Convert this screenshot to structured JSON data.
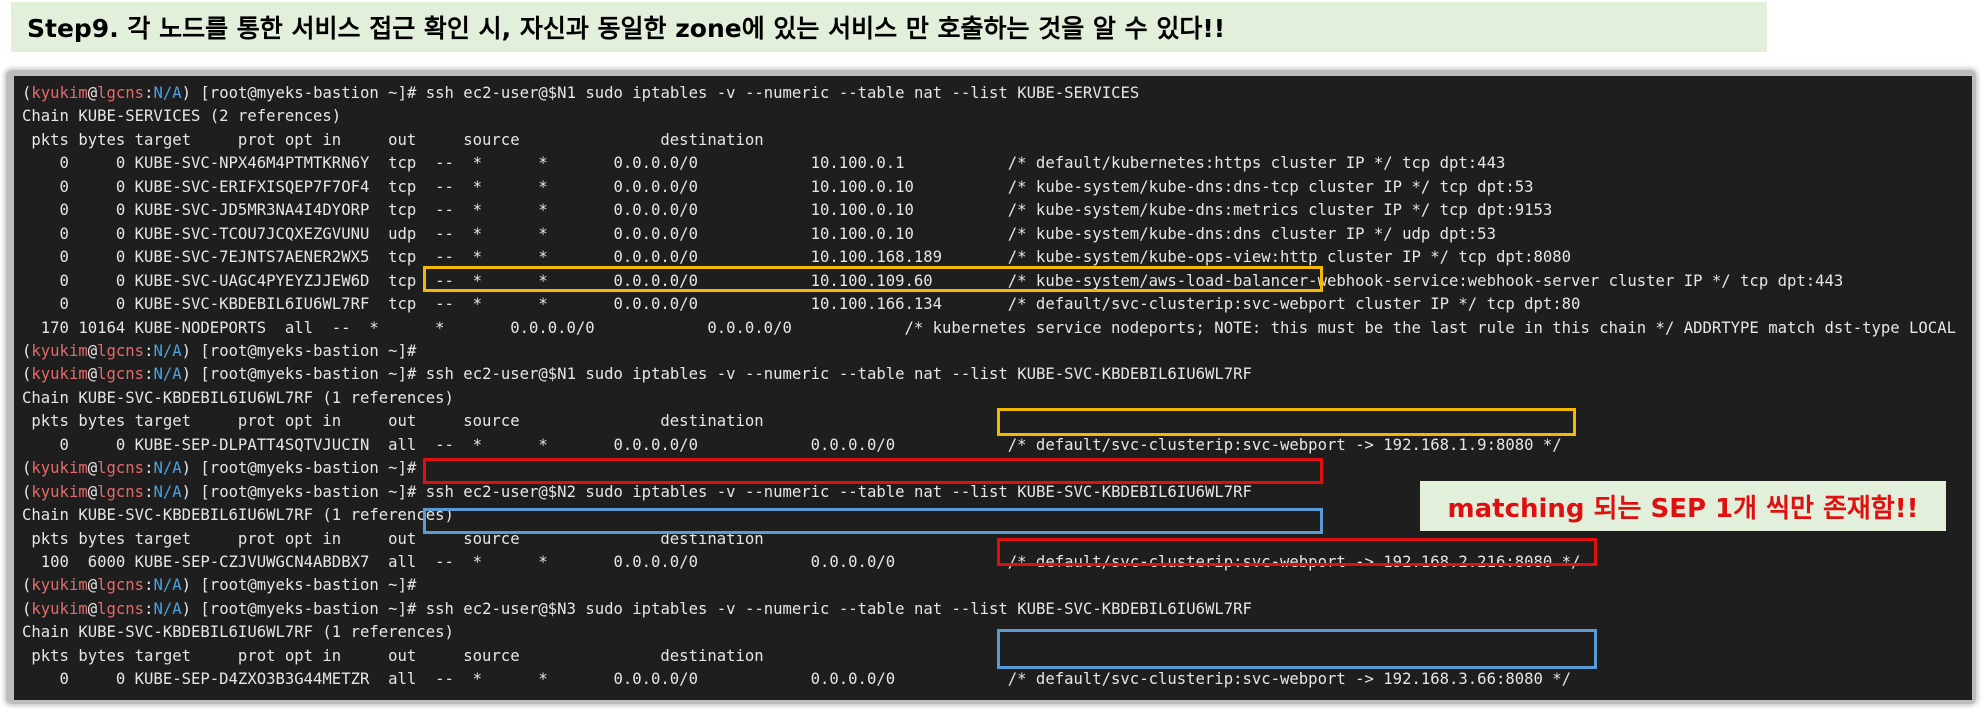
{
  "banner": {
    "text": "Step9. 각 노드를 통한 서비스 접근 확인 시, 자신과 동일한 zone에 있는 서비스 만 호출하는 것을 알 수 있다!!"
  },
  "prompt": {
    "user": "kyukim",
    "host": "lgcns",
    "path": "N/A",
    "shell": " [root@myeks-bastion ~]# "
  },
  "terminal_lines": [
    {
      "type": "prompt",
      "command": "ssh ec2-user@$N1 sudo iptables -v --numeric --table nat --list KUBE-SERVICES"
    },
    {
      "type": "text",
      "text": "Chain KUBE-SERVICES (2 references)"
    },
    {
      "type": "text",
      "text": " pkts bytes target     prot opt in     out     source               destination"
    },
    {
      "type": "text",
      "text": "    0     0 KUBE-SVC-NPX46M4PTMTKRN6Y  tcp  --  *      *       0.0.0.0/0            10.100.0.1           /* default/kubernetes:https cluster IP */ tcp dpt:443"
    },
    {
      "type": "text",
      "text": "    0     0 KUBE-SVC-ERIFXISQEP7F7OF4  tcp  --  *      *       0.0.0.0/0            10.100.0.10          /* kube-system/kube-dns:dns-tcp cluster IP */ tcp dpt:53"
    },
    {
      "type": "text",
      "text": "    0     0 KUBE-SVC-JD5MR3NA4I4DYORP  tcp  --  *      *       0.0.0.0/0            10.100.0.10          /* kube-system/kube-dns:metrics cluster IP */ tcp dpt:9153"
    },
    {
      "type": "text",
      "text": "    0     0 KUBE-SVC-TCOU7JCQXEZGVUNU  udp  --  *      *       0.0.0.0/0            10.100.0.10          /* kube-system/kube-dns:dns cluster IP */ udp dpt:53"
    },
    {
      "type": "text",
      "text": "    0     0 KUBE-SVC-7EJNTS7AENER2WX5  tcp  --  *      *       0.0.0.0/0            10.100.168.189       /* kube-system/kube-ops-view:http cluster IP */ tcp dpt:8080"
    },
    {
      "type": "text",
      "text": "    0     0 KUBE-SVC-UAGC4PYEYZJJEW6D  tcp  --  *      *       0.0.0.0/0            10.100.109.60        /* kube-system/aws-load-balancer-webhook-service:webhook-server cluster IP */ tcp dpt:443"
    },
    {
      "type": "text",
      "text": "    0     0 KUBE-SVC-KBDEBIL6IU6WL7RF  tcp  --  *      *       0.0.0.0/0            10.100.166.134       /* default/svc-clusterip:svc-webport cluster IP */ tcp dpt:80"
    },
    {
      "type": "text",
      "text": "  170 10164 KUBE-NODEPORTS  all  --  *      *       0.0.0.0/0            0.0.0.0/0            /* kubernetes service nodeports; NOTE: this must be the last rule in this chain */ ADDRTYPE match dst-type LOCAL"
    },
    {
      "type": "prompt",
      "command": ""
    },
    {
      "type": "prompt",
      "command": "ssh ec2-user@$N1 sudo iptables -v --numeric --table nat --list KUBE-SVC-KBDEBIL6IU6WL7RF"
    },
    {
      "type": "text",
      "text": "Chain KUBE-SVC-KBDEBIL6IU6WL7RF (1 references)"
    },
    {
      "type": "text",
      "text": " pkts bytes target     prot opt in     out     source               destination"
    },
    {
      "type": "text",
      "text": "    0     0 KUBE-SEP-DLPATT4SQTVJUCIN  all  --  *      *       0.0.0.0/0            0.0.0.0/0            /* default/svc-clusterip:svc-webport -> 192.168.1.9:8080 */"
    },
    {
      "type": "prompt",
      "command": ""
    },
    {
      "type": "prompt",
      "command": "ssh ec2-user@$N2 sudo iptables -v --numeric --table nat --list KUBE-SVC-KBDEBIL6IU6WL7RF"
    },
    {
      "type": "text",
      "text": "Chain KUBE-SVC-KBDEBIL6IU6WL7RF (1 references)"
    },
    {
      "type": "text",
      "text": " pkts bytes target     prot opt in     out     source               destination"
    },
    {
      "type": "text",
      "text": "  100  6000 KUBE-SEP-CZJVUWGCN4ABDBX7  all  --  *      *       0.0.0.0/0            0.0.0.0/0            /* default/svc-clusterip:svc-webport -> 192.168.2.216:8080 */"
    },
    {
      "type": "prompt",
      "command": ""
    },
    {
      "type": "prompt",
      "command": "ssh ec2-user@$N3 sudo iptables -v --numeric --table nat --list KUBE-SVC-KBDEBIL6IU6WL7RF"
    },
    {
      "type": "text",
      "text": "Chain KUBE-SVC-KBDEBIL6IU6WL7RF (1 references)"
    },
    {
      "type": "text",
      "text": " pkts bytes target     prot opt in     out     source               destination"
    },
    {
      "type": "text",
      "text": "    0     0 KUBE-SEP-D4ZXO3B3G44METZR  all  --  *      *       0.0.0.0/0            0.0.0.0/0            /* default/svc-clusterip:svc-webport -> 192.168.3.66:8080 */"
    }
  ],
  "highlights": [
    {
      "name": "highlight-n1-command",
      "color": "#f5b800"
    },
    {
      "name": "highlight-n1-endpoint",
      "color": "#f5b800"
    },
    {
      "name": "highlight-n2-command",
      "color": "#e01010"
    },
    {
      "name": "highlight-n2-endpoint",
      "color": "#e01010"
    },
    {
      "name": "highlight-n3-command",
      "color": "#5b9bd5"
    },
    {
      "name": "highlight-n3-endpoint",
      "color": "#5b9bd5"
    }
  ],
  "callout": {
    "text": "matching 되는 SEP 1개 씩만 존재함!!",
    "color": "#e01010"
  }
}
